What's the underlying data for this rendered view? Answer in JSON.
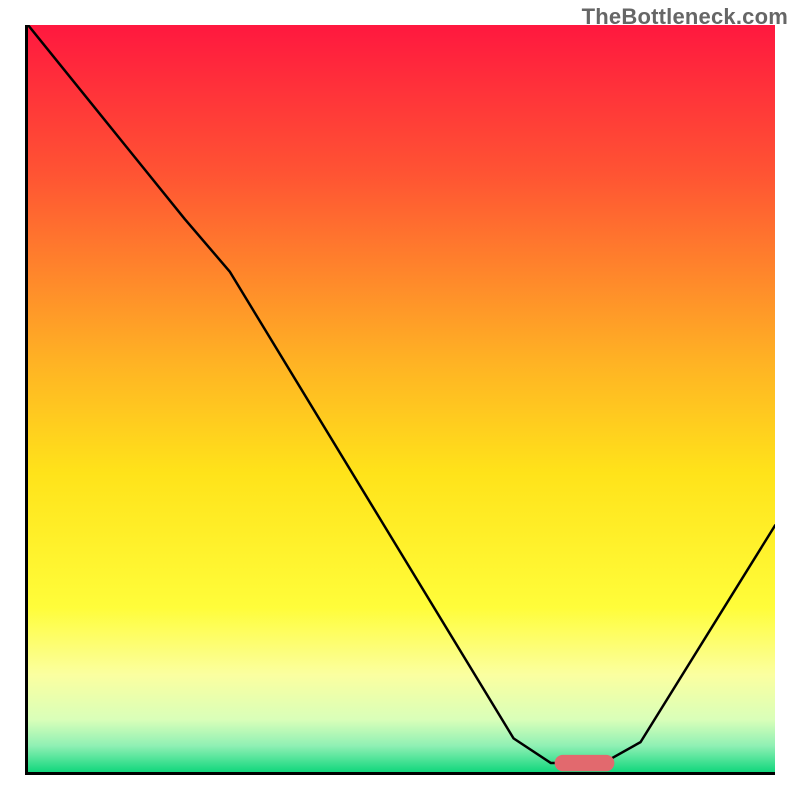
{
  "watermark": "TheBottleneck.com",
  "chart_data": {
    "type": "line",
    "title": "",
    "xlabel": "",
    "ylabel": "",
    "xlim": [
      0,
      100
    ],
    "ylim": [
      0,
      100
    ],
    "grid": false,
    "legend": false,
    "background_gradient": {
      "stops": [
        {
          "offset": 0.0,
          "color": "#ff183f"
        },
        {
          "offset": 0.2,
          "color": "#ff5433"
        },
        {
          "offset": 0.45,
          "color": "#ffb224"
        },
        {
          "offset": 0.6,
          "color": "#ffe31a"
        },
        {
          "offset": 0.78,
          "color": "#fffd3a"
        },
        {
          "offset": 0.87,
          "color": "#fbffa0"
        },
        {
          "offset": 0.93,
          "color": "#d9ffb9"
        },
        {
          "offset": 0.965,
          "color": "#8ff0b4"
        },
        {
          "offset": 1.0,
          "color": "#12d77d"
        }
      ]
    },
    "series": [
      {
        "name": "bottleneck-curve",
        "color": "#000000",
        "stroke_width": 2.5,
        "points": [
          {
            "x": 0.0,
            "y": 100.0
          },
          {
            "x": 21.0,
            "y": 74.0
          },
          {
            "x": 27.0,
            "y": 67.0
          },
          {
            "x": 65.0,
            "y": 4.5
          },
          {
            "x": 70.0,
            "y": 1.2
          },
          {
            "x": 77.0,
            "y": 1.2
          },
          {
            "x": 82.0,
            "y": 4.0
          },
          {
            "x": 100.0,
            "y": 33.0
          }
        ]
      }
    ],
    "annotations": [
      {
        "name": "optimal-pill",
        "shape": "capsule",
        "color": "#e2696e",
        "x_start": 70.5,
        "x_end": 78.5,
        "y": 1.2,
        "height": 2.2
      }
    ]
  }
}
